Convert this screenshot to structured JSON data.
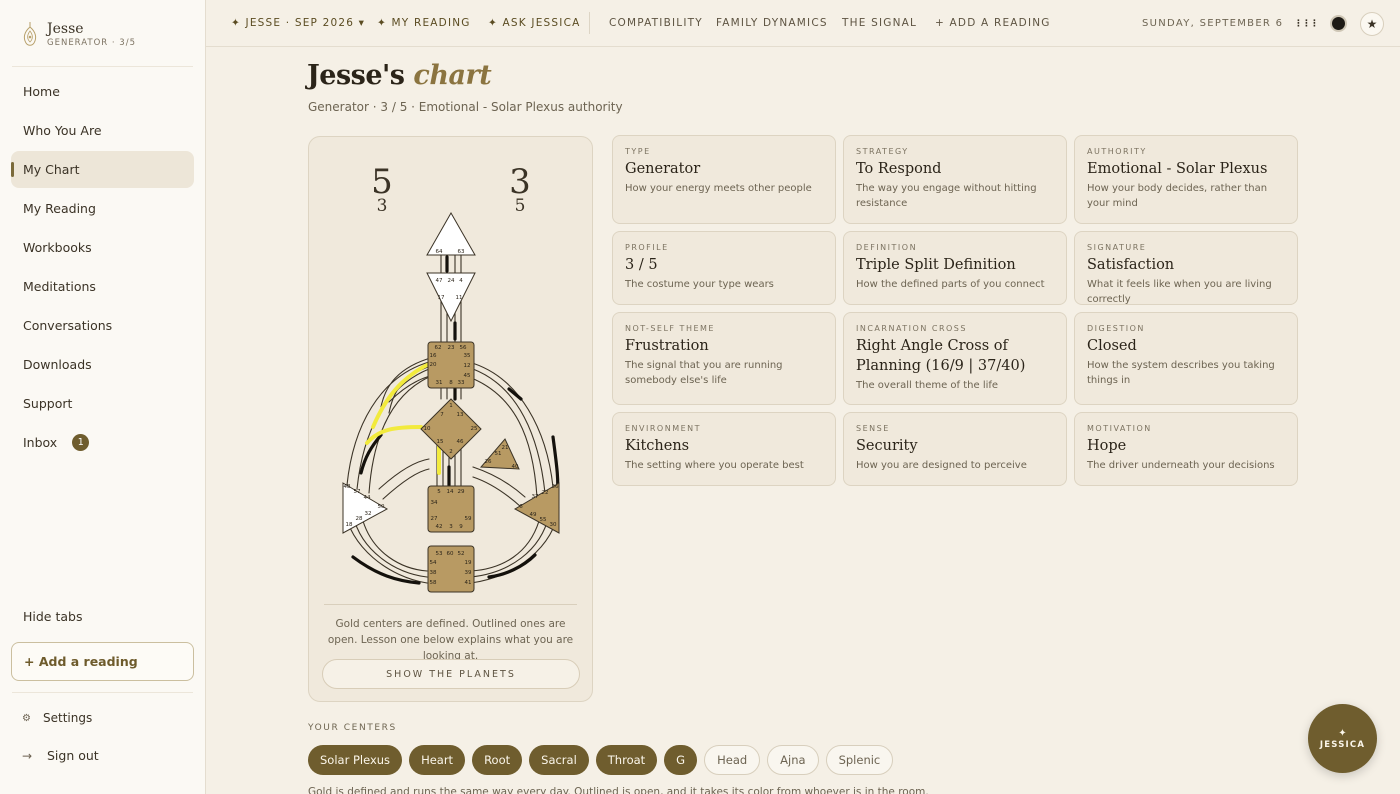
{
  "sidebar": {
    "brand_name": "Jesse",
    "brand_sub": "GENERATOR · 3/5",
    "items": [
      {
        "label": "Home"
      },
      {
        "label": "Who You Are"
      },
      {
        "label": "My Chart"
      },
      {
        "label": "My Reading"
      },
      {
        "label": "Workbooks"
      },
      {
        "label": "Meditations"
      },
      {
        "label": "Conversations"
      },
      {
        "label": "Downloads"
      },
      {
        "label": "Support"
      },
      {
        "label": "Inbox",
        "badge": "1"
      }
    ],
    "hide_tabs": "Hide tabs",
    "add_reading": "+ Add a reading",
    "settings": "Settings",
    "sign_out": "Sign out"
  },
  "topbar": {
    "nav": [
      {
        "label": "✦ JESSE · SEP 2026 ▾"
      },
      {
        "label": "✦ MY READING"
      },
      {
        "label": "✦ ASK JESSICA"
      },
      {
        "label": "COMPATIBILITY"
      },
      {
        "label": "FAMILY DYNAMICS"
      },
      {
        "label": "THE SIGNAL"
      },
      {
        "label": "+ ADD A READING"
      }
    ],
    "date": "SUNDAY, SEPTEMBER 6",
    "menu_glyph": "⋮⋮⋮",
    "star_glyph": "★"
  },
  "page": {
    "title_name": "Jesse's",
    "title_word": "chart",
    "subtitle": "Generator · 3 / 5 · Emotional - Solar Plexus authority"
  },
  "chart": {
    "profile_left_top": "5",
    "profile_left_bottom": "3",
    "profile_right_top": "3",
    "profile_right_bottom": "5",
    "gates": {
      "head": [
        "64",
        "63"
      ],
      "ajna": [
        "47",
        "24",
        "4",
        "17",
        "11"
      ],
      "throat": [
        "62",
        "23",
        "56",
        "16",
        "35",
        "20",
        "12",
        "45",
        "31",
        "8",
        "33"
      ],
      "g": [
        "1",
        "7",
        "13",
        "10",
        "25",
        "15",
        "46",
        "2"
      ],
      "heart": [
        "21",
        "51",
        "26",
        "40"
      ],
      "spleen": [
        "48",
        "57",
        "44",
        "50",
        "32",
        "28",
        "18"
      ],
      "sacral": [
        "5",
        "14",
        "29",
        "34",
        "27",
        "59",
        "42",
        "3",
        "9"
      ],
      "solar": [
        "36",
        "22",
        "37",
        "6",
        "49",
        "55",
        "30"
      ],
      "root": [
        "53",
        "60",
        "52",
        "54",
        "19",
        "38",
        "39",
        "58",
        "41"
      ]
    },
    "caption": "Gold centers are defined. Outlined ones are open. Lesson one below explains what you are looking at.",
    "planets_button": "SHOW THE PLANETS"
  },
  "cards": [
    {
      "label": "TYPE",
      "value": "Generator",
      "desc": "How your energy meets other people"
    },
    {
      "label": "STRATEGY",
      "value": "To Respond",
      "desc": "The way you engage without hitting resistance"
    },
    {
      "label": "AUTHORITY",
      "value": "Emotional - Solar Plexus",
      "desc": "How your body decides, rather than your mind"
    },
    {
      "label": "PROFILE",
      "value": "3 / 5",
      "desc": "The costume your type wears"
    },
    {
      "label": "DEFINITION",
      "value": "Triple Split Definition",
      "desc": "How the defined parts of you connect"
    },
    {
      "label": "SIGNATURE",
      "value": "Satisfaction",
      "desc": "What it feels like when you are living correctly"
    },
    {
      "label": "NOT-SELF THEME",
      "value": "Frustration",
      "desc": "The signal that you are running somebody else's life"
    },
    {
      "label": "INCARNATION CROSS",
      "value": "Right Angle Cross of Planning (16/9 | 37/40)",
      "desc": "The overall theme of the life"
    },
    {
      "label": "DIGESTION",
      "value": "Closed",
      "desc": "How the system describes you taking things in"
    },
    {
      "label": "ENVIRONMENT",
      "value": "Kitchens",
      "desc": "The setting where you operate best"
    },
    {
      "label": "SENSE",
      "value": "Security",
      "desc": "How you are designed to perceive"
    },
    {
      "label": "MOTIVATION",
      "value": "Hope",
      "desc": "The driver underneath your decisions"
    }
  ],
  "centers": {
    "label": "YOUR CENTERS",
    "defined": [
      "Solar Plexus",
      "Heart",
      "Root",
      "Sacral",
      "Throat",
      "G"
    ],
    "open": [
      "Head",
      "Ajna",
      "Splenic"
    ],
    "footnote": "Gold is defined and runs the same way every day. Outlined is open, and it takes its color from whoever is in the room."
  },
  "jessica": {
    "glyph": "✦",
    "label": "JESSICA"
  },
  "colors": {
    "accent": "#6f5d2e",
    "background": "#f5f0e6",
    "defined_center": "#b89a63",
    "active_channel": "#f2ea3d"
  }
}
